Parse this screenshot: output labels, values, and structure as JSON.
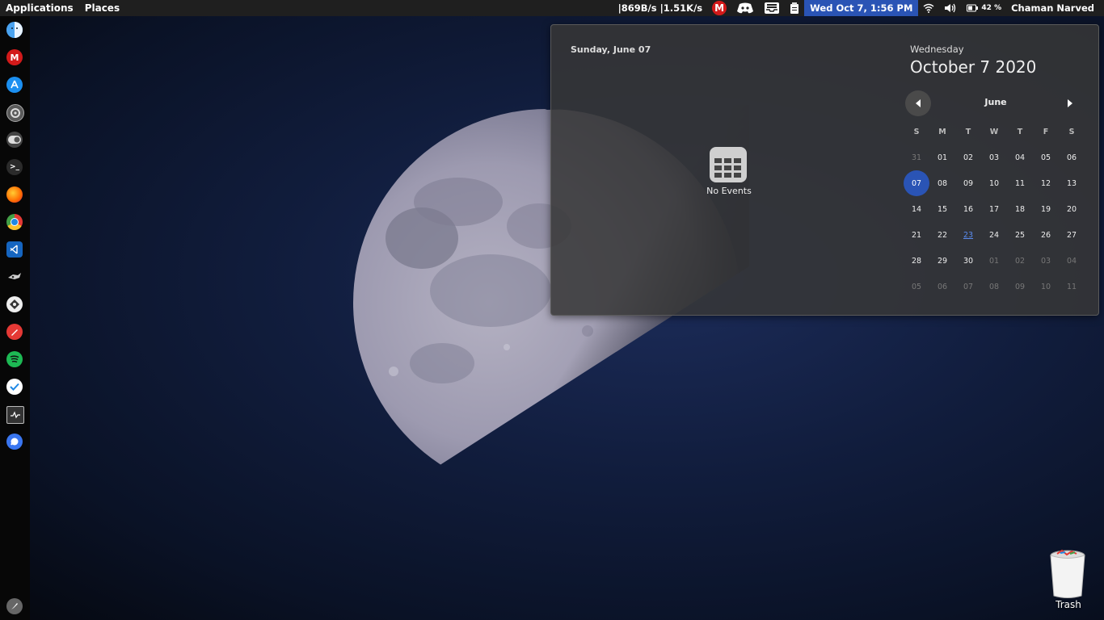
{
  "topbar": {
    "applications": "Applications",
    "places": "Places",
    "network": "|869B/s |1.51K/s",
    "mega_letter": "M",
    "clock": "Wed Oct  7,  1:56 PM",
    "battery": "42 %",
    "user": "Chaman Narved"
  },
  "dock": {
    "icons": [
      "finder-icon",
      "mega-icon",
      "app-store-icon",
      "settings-icon",
      "toggle-icon",
      "terminal-icon",
      "firefox-icon",
      "chrome-icon",
      "vscode-icon",
      "hacker-icon",
      "sentinel-icon",
      "pen-icon",
      "spotify-icon",
      "todo-icon",
      "system-monitor-icon",
      "signal-icon",
      "launcher-icon"
    ]
  },
  "calendar": {
    "selected_date_header": "Sunday, June 07",
    "no_events": "No Events",
    "weekday": "Wednesday",
    "today": "October  7 2020",
    "month": "June",
    "day_headers": [
      "S",
      "M",
      "T",
      "W",
      "T",
      "F",
      "S"
    ],
    "weeks": [
      [
        "31",
        "01",
        "02",
        "03",
        "04",
        "05",
        "06"
      ],
      [
        "07",
        "08",
        "09",
        "10",
        "11",
        "12",
        "13"
      ],
      [
        "14",
        "15",
        "16",
        "17",
        "18",
        "19",
        "20"
      ],
      [
        "21",
        "22",
        "23",
        "24",
        "25",
        "26",
        "27"
      ],
      [
        "28",
        "29",
        "30",
        "01",
        "02",
        "03",
        "04"
      ],
      [
        "05",
        "06",
        "07",
        "08",
        "09",
        "10",
        "11"
      ]
    ]
  },
  "desktop": {
    "trash_label": "Trash"
  }
}
